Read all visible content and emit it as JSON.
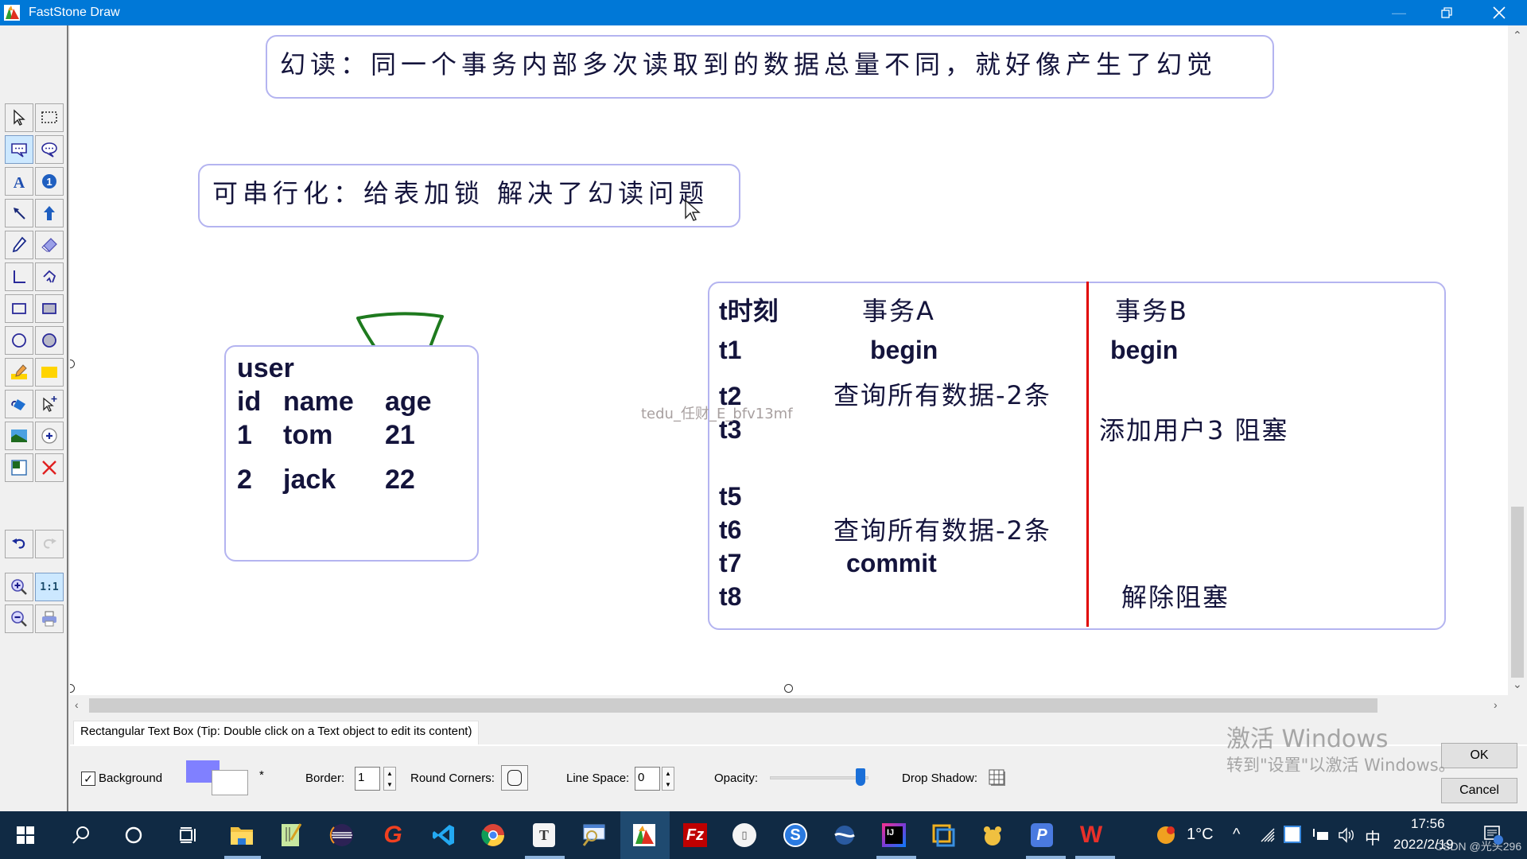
{
  "window": {
    "title": "FastStone Draw",
    "minimize_icon": "minimize-icon",
    "restore_icon": "restore-icon",
    "close_icon": "close-icon"
  },
  "toolbar": {
    "tools": [
      {
        "name": "select-tool",
        "icon": "arrow-cursor-icon"
      },
      {
        "name": "rect-select-tool",
        "icon": "dashed-rect-icon"
      },
      {
        "name": "rect-callout-tool",
        "icon": "rect-callout-icon",
        "active": true
      },
      {
        "name": "round-callout-tool",
        "icon": "round-callout-icon"
      },
      {
        "name": "text-tool",
        "icon": "letter-a-icon"
      },
      {
        "name": "number-tool",
        "icon": "number-badge-icon"
      },
      {
        "name": "arrow-line-tool",
        "icon": "arrow-line-icon"
      },
      {
        "name": "thick-arrow-tool",
        "icon": "thick-arrow-icon"
      },
      {
        "name": "pen-tool",
        "icon": "pen-icon"
      },
      {
        "name": "eraser-tool",
        "icon": "eraser-icon"
      },
      {
        "name": "line-tool",
        "icon": "polyline-icon"
      },
      {
        "name": "curve-tool",
        "icon": "curve-icon"
      },
      {
        "name": "rectangle-tool",
        "icon": "rectangle-icon"
      },
      {
        "name": "filled-rectangle-tool",
        "icon": "filled-rectangle-icon"
      },
      {
        "name": "ellipse-tool",
        "icon": "ellipse-icon"
      },
      {
        "name": "filled-ellipse-tool",
        "icon": "filled-ellipse-icon"
      },
      {
        "name": "highlighter-tool",
        "icon": "highlighter-icon"
      },
      {
        "name": "highlight-rect-tool",
        "icon": "yellow-rect-icon"
      },
      {
        "name": "fill-tool",
        "icon": "paint-bucket-icon"
      },
      {
        "name": "add-cursor-tool",
        "icon": "cursor-plus-icon"
      },
      {
        "name": "insert-image-tool",
        "icon": "image-icon"
      },
      {
        "name": "stamp-tool",
        "icon": "circle-plus-icon"
      },
      {
        "name": "crop-tool",
        "icon": "crop-icon"
      },
      {
        "name": "delete-tool",
        "icon": "red-x-icon"
      }
    ],
    "undo_icon": "undo-icon",
    "redo_icon": "redo-icon",
    "zoom_in_icon": "zoom-in-icon",
    "actual_size_label": "1:1",
    "zoom_out_icon": "zoom-out-icon",
    "print_icon": "printer-icon"
  },
  "canvas": {
    "phantom_read_box": "幻读：同一个事务内部多次读取到的数据总量不同，就好像产生了幻觉",
    "serializable_box": "可串行化：给表加锁 解决了幻读问题",
    "user_table": {
      "title": "user",
      "headers": [
        "id",
        "name",
        "age"
      ],
      "rows": [
        [
          "1",
          "tom",
          "21"
        ],
        [
          "2",
          "jack",
          "22"
        ]
      ]
    },
    "transactions": {
      "headers": [
        "t时刻",
        "事务A",
        "事务B"
      ],
      "rows": [
        {
          "t": "t1",
          "a": "begin",
          "b": "begin"
        },
        {
          "t": "t2",
          "a": "查询所有数据-2条",
          "b": ""
        },
        {
          "t": "t3",
          "a": "",
          "b": "添加用户3 阻塞"
        },
        {
          "t": "t5",
          "a": "",
          "b": ""
        },
        {
          "t": "t6",
          "a": "查询所有数据-2条",
          "b": ""
        },
        {
          "t": "t7",
          "a": "commit",
          "b": ""
        },
        {
          "t": "t8",
          "a": "",
          "b": "解除阻塞"
        }
      ]
    },
    "watermark": "tedu_任财_E_bfv13mf"
  },
  "properties": {
    "tab_label": "Rectangular Text Box (Tip: Double click on a Text object to edit its content)",
    "background_label": "Background",
    "background_checked": true,
    "fill_color": "#8080ff",
    "border_color": "#ffffff",
    "asterisk": "*",
    "border_label": "Border:",
    "border_value": "1",
    "round_corners_label": "Round Corners:",
    "line_space_label": "Line Space:",
    "line_space_value": "0",
    "opacity_label": "Opacity:",
    "opacity_value": 1.0,
    "drop_shadow_label": "Drop Shadow:",
    "ok_label": "OK",
    "cancel_label": "Cancel"
  },
  "activation": {
    "line1": "激活 Windows",
    "line2": "转到\"设置\"以激活 Windows。"
  },
  "taskbar": {
    "apps": [
      "start-button",
      "search-button",
      "cortana-button",
      "task-view-button",
      "file-explorer",
      "notepad-plus",
      "eclipse",
      "foxit",
      "vscode",
      "chrome",
      "typora",
      "snipping",
      "faststone-draw",
      "filezilla",
      "app-round",
      "sogou",
      "app-orb",
      "intellij",
      "vmware",
      "app-yellow",
      "app-p",
      "wps"
    ],
    "weather": "1°C",
    "ime": "中",
    "time": "17:56",
    "date": "2022/2/19",
    "overlay_watermark": "CSDN @光头296"
  },
  "colors": {
    "titlebar": "#0078d7",
    "box_border": "#b4b4f0",
    "text": "#14143c",
    "divider_red": "#e00000",
    "shape_green": "#1e7a1e",
    "taskbar": "#102a44"
  }
}
